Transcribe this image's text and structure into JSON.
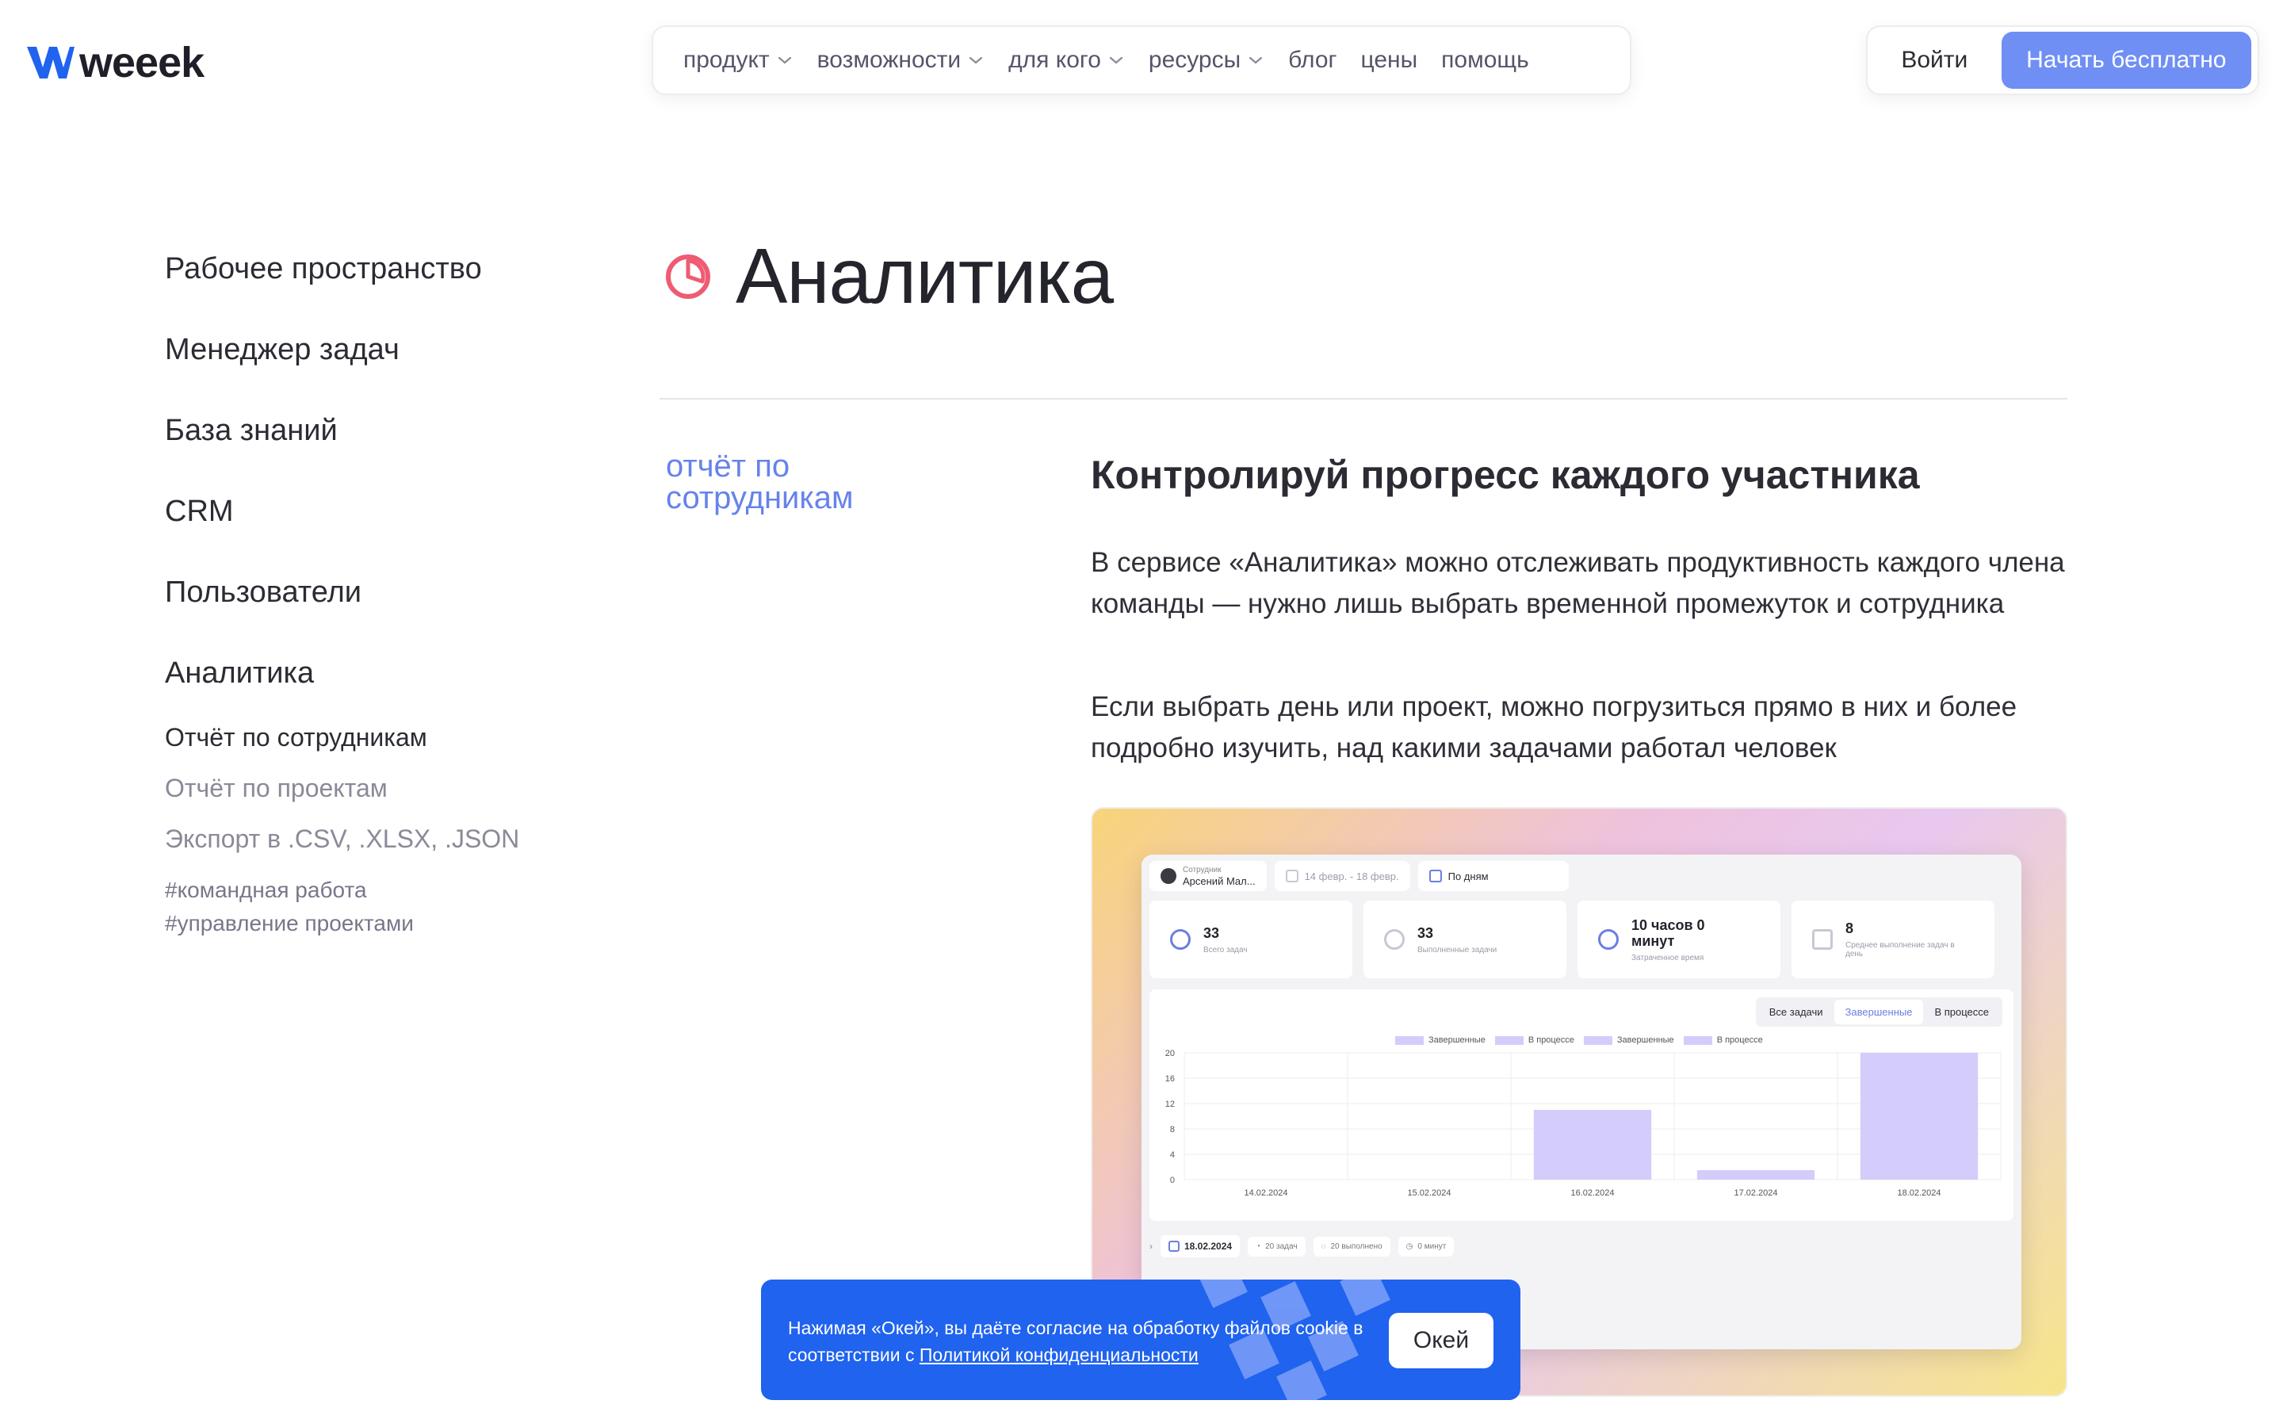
{
  "header": {
    "logo_text": "weeek",
    "nav": [
      {
        "label": "продукт",
        "dropdown": true
      },
      {
        "label": "возможности",
        "dropdown": true
      },
      {
        "label": "для кого",
        "dropdown": true
      },
      {
        "label": "ресурсы",
        "dropdown": true
      },
      {
        "label": "блог",
        "dropdown": false
      },
      {
        "label": "цены",
        "dropdown": false
      },
      {
        "label": "помощь",
        "dropdown": false
      }
    ],
    "login_label": "Войти",
    "start_label": "Начать бесплатно"
  },
  "colors": {
    "accent": "#6f8ff5",
    "link": "#6683ea",
    "cookie_bg": "#1f63ef",
    "bar": "#d4ccfb"
  },
  "sidebar": {
    "main_items": [
      "Рабочее пространство",
      "Менеджер задач",
      "База знаний",
      "CRM",
      "Пользователи",
      "Аналитика"
    ],
    "sub_items": [
      "Отчёт по сотрудникам",
      "Отчёт по проектам",
      "Экспорт в .CSV, .XLSX, .JSON"
    ],
    "tags": [
      "#командная работа",
      "#управление проектами"
    ]
  },
  "main": {
    "title": "Аналитика",
    "title_icon": "pie-chart-icon",
    "section_link": "отчёт по сотрудникам",
    "heading": "Контролируй прогресс каждого участника",
    "para1": "В сервисе «Аналитика» можно отслеживать продуктивность каждого члена команды — нужно лишь выбрать временной промежуток и сотрудника",
    "para2": "Если выбрать день или проект, можно погрузиться прямо в них и более подробно изучить, над какими задачами работал человек"
  },
  "preview": {
    "employee_caption": "Сотрудник",
    "employee_name": "Арсений Мал...",
    "date_range": "14 февр. - 18 февр.",
    "group_by": "По дням",
    "stats": [
      {
        "value": "33",
        "caption": "Всего задач"
      },
      {
        "value": "33",
        "caption": "Выполненные задачи"
      },
      {
        "value": "10 часов 0 минут",
        "caption": "Затраченное время"
      },
      {
        "value": "8",
        "caption": "Среднее выполнение задач в день"
      }
    ],
    "tabs": [
      "Все задачи",
      "Завершенные",
      "В процессе"
    ],
    "selected_tab": "Завершенные",
    "legend": [
      "Завершенные",
      "В процессе",
      "Завершенные",
      "В процессе"
    ],
    "day": {
      "date": "18.02.2024",
      "tasks": "20 задач",
      "done": "20 выполнено",
      "time": "0 минут"
    }
  },
  "chart_data": {
    "type": "bar",
    "categories": [
      "14.02.2024",
      "15.02.2024",
      "16.02.2024",
      "17.02.2024",
      "18.02.2024"
    ],
    "values": [
      0,
      0,
      11,
      1.5,
      20
    ],
    "ylim": [
      0,
      20
    ],
    "yticks": [
      0,
      4,
      8,
      12,
      16,
      20
    ],
    "grid": true
  },
  "cookie": {
    "text": "Нажимая «Окей», вы даёте согласие на обработку файлов cookie в соответствии с ",
    "link_text": "Политикой конфиденциальности",
    "ok_label": "Окей"
  }
}
